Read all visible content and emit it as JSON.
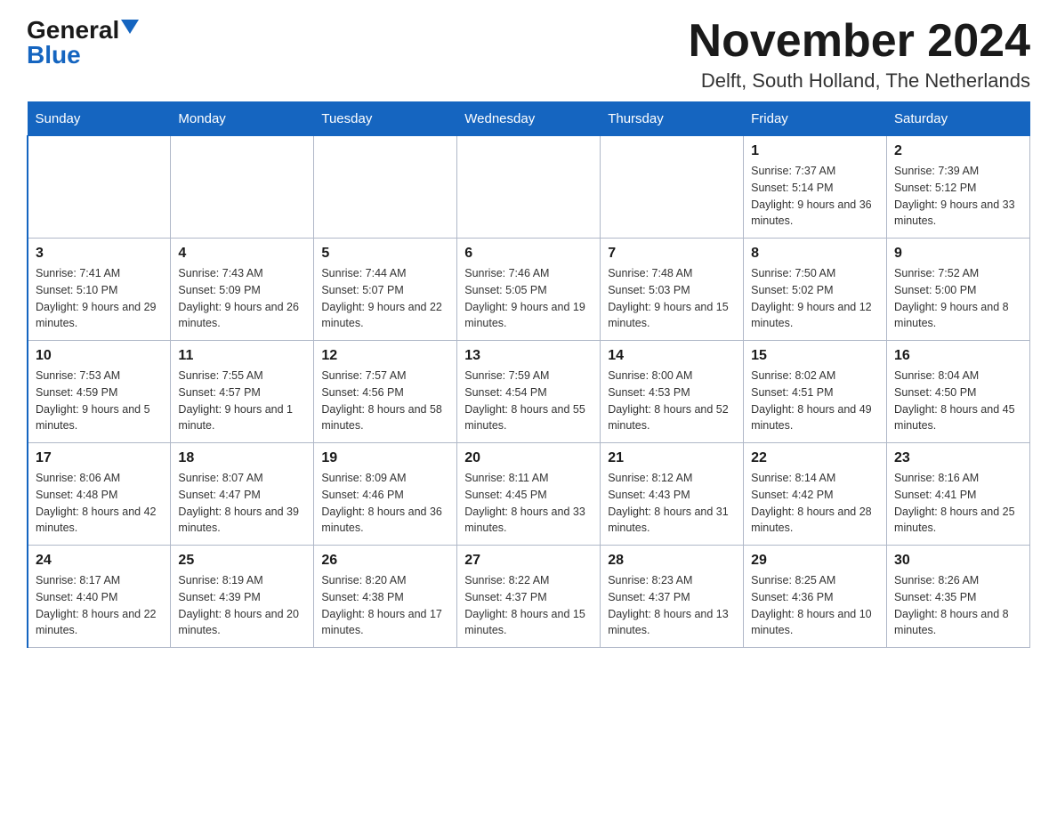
{
  "logo": {
    "general": "General",
    "blue": "Blue"
  },
  "header": {
    "month_year": "November 2024",
    "location": "Delft, South Holland, The Netherlands"
  },
  "weekdays": [
    "Sunday",
    "Monday",
    "Tuesday",
    "Wednesday",
    "Thursday",
    "Friday",
    "Saturday"
  ],
  "weeks": [
    [
      {
        "day": "",
        "info": ""
      },
      {
        "day": "",
        "info": ""
      },
      {
        "day": "",
        "info": ""
      },
      {
        "day": "",
        "info": ""
      },
      {
        "day": "",
        "info": ""
      },
      {
        "day": "1",
        "info": "Sunrise: 7:37 AM\nSunset: 5:14 PM\nDaylight: 9 hours and 36 minutes."
      },
      {
        "day": "2",
        "info": "Sunrise: 7:39 AM\nSunset: 5:12 PM\nDaylight: 9 hours and 33 minutes."
      }
    ],
    [
      {
        "day": "3",
        "info": "Sunrise: 7:41 AM\nSunset: 5:10 PM\nDaylight: 9 hours and 29 minutes."
      },
      {
        "day": "4",
        "info": "Sunrise: 7:43 AM\nSunset: 5:09 PM\nDaylight: 9 hours and 26 minutes."
      },
      {
        "day": "5",
        "info": "Sunrise: 7:44 AM\nSunset: 5:07 PM\nDaylight: 9 hours and 22 minutes."
      },
      {
        "day": "6",
        "info": "Sunrise: 7:46 AM\nSunset: 5:05 PM\nDaylight: 9 hours and 19 minutes."
      },
      {
        "day": "7",
        "info": "Sunrise: 7:48 AM\nSunset: 5:03 PM\nDaylight: 9 hours and 15 minutes."
      },
      {
        "day": "8",
        "info": "Sunrise: 7:50 AM\nSunset: 5:02 PM\nDaylight: 9 hours and 12 minutes."
      },
      {
        "day": "9",
        "info": "Sunrise: 7:52 AM\nSunset: 5:00 PM\nDaylight: 9 hours and 8 minutes."
      }
    ],
    [
      {
        "day": "10",
        "info": "Sunrise: 7:53 AM\nSunset: 4:59 PM\nDaylight: 9 hours and 5 minutes."
      },
      {
        "day": "11",
        "info": "Sunrise: 7:55 AM\nSunset: 4:57 PM\nDaylight: 9 hours and 1 minute."
      },
      {
        "day": "12",
        "info": "Sunrise: 7:57 AM\nSunset: 4:56 PM\nDaylight: 8 hours and 58 minutes."
      },
      {
        "day": "13",
        "info": "Sunrise: 7:59 AM\nSunset: 4:54 PM\nDaylight: 8 hours and 55 minutes."
      },
      {
        "day": "14",
        "info": "Sunrise: 8:00 AM\nSunset: 4:53 PM\nDaylight: 8 hours and 52 minutes."
      },
      {
        "day": "15",
        "info": "Sunrise: 8:02 AM\nSunset: 4:51 PM\nDaylight: 8 hours and 49 minutes."
      },
      {
        "day": "16",
        "info": "Sunrise: 8:04 AM\nSunset: 4:50 PM\nDaylight: 8 hours and 45 minutes."
      }
    ],
    [
      {
        "day": "17",
        "info": "Sunrise: 8:06 AM\nSunset: 4:48 PM\nDaylight: 8 hours and 42 minutes."
      },
      {
        "day": "18",
        "info": "Sunrise: 8:07 AM\nSunset: 4:47 PM\nDaylight: 8 hours and 39 minutes."
      },
      {
        "day": "19",
        "info": "Sunrise: 8:09 AM\nSunset: 4:46 PM\nDaylight: 8 hours and 36 minutes."
      },
      {
        "day": "20",
        "info": "Sunrise: 8:11 AM\nSunset: 4:45 PM\nDaylight: 8 hours and 33 minutes."
      },
      {
        "day": "21",
        "info": "Sunrise: 8:12 AM\nSunset: 4:43 PM\nDaylight: 8 hours and 31 minutes."
      },
      {
        "day": "22",
        "info": "Sunrise: 8:14 AM\nSunset: 4:42 PM\nDaylight: 8 hours and 28 minutes."
      },
      {
        "day": "23",
        "info": "Sunrise: 8:16 AM\nSunset: 4:41 PM\nDaylight: 8 hours and 25 minutes."
      }
    ],
    [
      {
        "day": "24",
        "info": "Sunrise: 8:17 AM\nSunset: 4:40 PM\nDaylight: 8 hours and 22 minutes."
      },
      {
        "day": "25",
        "info": "Sunrise: 8:19 AM\nSunset: 4:39 PM\nDaylight: 8 hours and 20 minutes."
      },
      {
        "day": "26",
        "info": "Sunrise: 8:20 AM\nSunset: 4:38 PM\nDaylight: 8 hours and 17 minutes."
      },
      {
        "day": "27",
        "info": "Sunrise: 8:22 AM\nSunset: 4:37 PM\nDaylight: 8 hours and 15 minutes."
      },
      {
        "day": "28",
        "info": "Sunrise: 8:23 AM\nSunset: 4:37 PM\nDaylight: 8 hours and 13 minutes."
      },
      {
        "day": "29",
        "info": "Sunrise: 8:25 AM\nSunset: 4:36 PM\nDaylight: 8 hours and 10 minutes."
      },
      {
        "day": "30",
        "info": "Sunrise: 8:26 AM\nSunset: 4:35 PM\nDaylight: 8 hours and 8 minutes."
      }
    ]
  ]
}
